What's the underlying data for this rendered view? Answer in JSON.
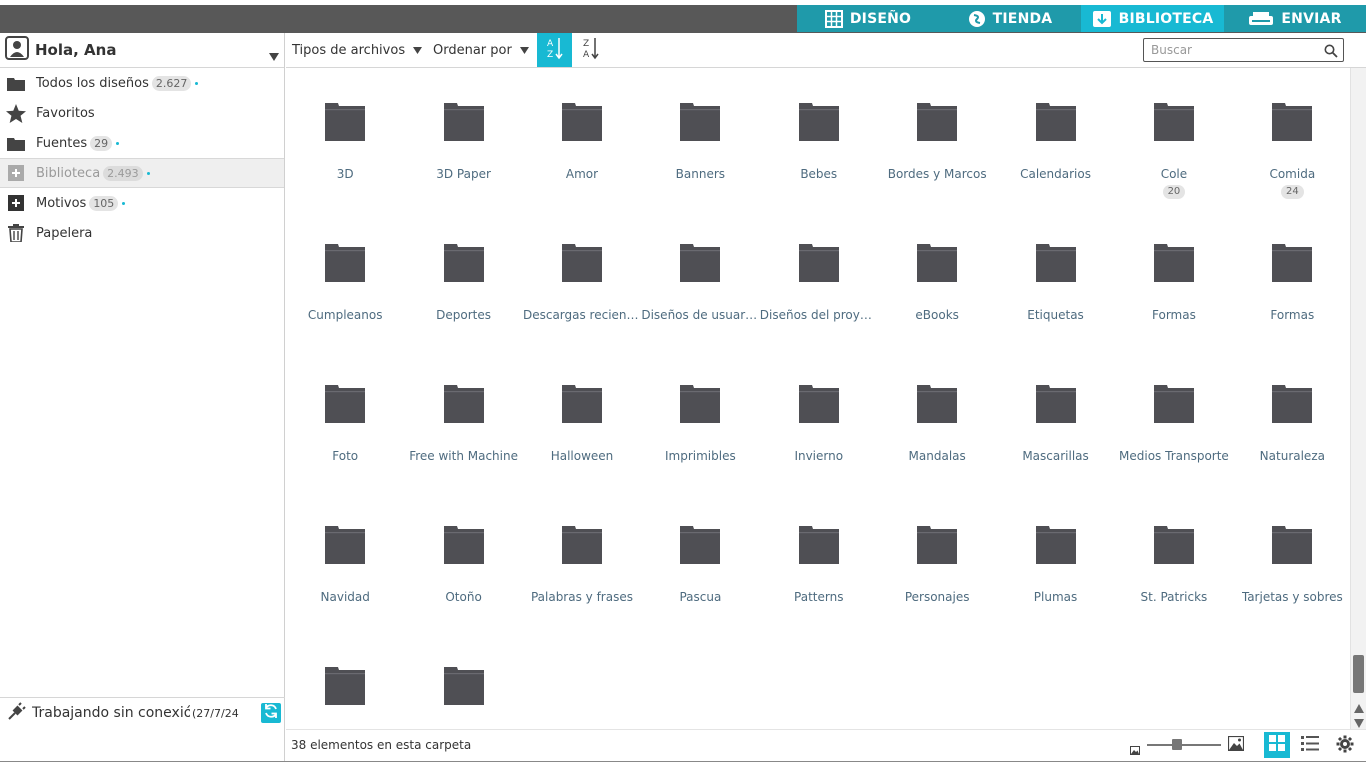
{
  "header": {
    "tabs": [
      {
        "label": "DISEÑO",
        "icon": "grid-icon"
      },
      {
        "label": "TIENDA",
        "icon": "store-icon"
      },
      {
        "label": "BIBLIOTECA",
        "icon": "download-icon"
      },
      {
        "label": "ENVIAR",
        "icon": "printer-icon"
      }
    ],
    "active_tab": "BIBLIOTECA",
    "colors": {
      "accent": "#18b9d3",
      "tab_bg": "#1f9aaa",
      "topbar": "#585858"
    }
  },
  "sidebar": {
    "user": "Hola, Ana",
    "items": [
      {
        "label": "Todos los diseños",
        "count": "2.627",
        "icon": "folder-icon"
      },
      {
        "label": "Favoritos",
        "count": "",
        "icon": "star-icon"
      },
      {
        "label": "Fuentes",
        "count": "29",
        "icon": "folder-icon"
      },
      {
        "label": "Biblioteca",
        "count": "2.493",
        "icon": "plus-box-icon"
      },
      {
        "label": "Motivos",
        "count": "105",
        "icon": "plus-box-icon"
      },
      {
        "label": "Papelera",
        "count": "",
        "icon": "trash-icon"
      }
    ],
    "offline_text": "Trabajando sin conexión",
    "offline_date": "(27/7/24"
  },
  "toolbar": {
    "file_types": "Tipos de archivos",
    "order_by": "Ordenar por",
    "sort_az": {
      "top": "A",
      "bottom": "Z"
    },
    "sort_za": {
      "top": "Z",
      "bottom": "A"
    },
    "search_placeholder": "Buscar"
  },
  "folders": [
    {
      "name": "3D",
      "count": ""
    },
    {
      "name": "3D Paper",
      "count": ""
    },
    {
      "name": "Amor",
      "count": ""
    },
    {
      "name": "Banners",
      "count": ""
    },
    {
      "name": "Bebes",
      "count": ""
    },
    {
      "name": "Bordes y Marcos",
      "count": ""
    },
    {
      "name": "Calendarios",
      "count": ""
    },
    {
      "name": "Cole",
      "count": "20"
    },
    {
      "name": "Comida",
      "count": "24"
    },
    {
      "name": "Cumpleanos",
      "count": ""
    },
    {
      "name": "Deportes",
      "count": ""
    },
    {
      "name": "Descargas recientes",
      "count": ""
    },
    {
      "name": "Diseños de usuarios",
      "count": ""
    },
    {
      "name": "Diseños del proye...",
      "count": ""
    },
    {
      "name": "eBooks",
      "count": ""
    },
    {
      "name": "Etiquetas",
      "count": ""
    },
    {
      "name": "Formas",
      "count": ""
    },
    {
      "name": "Formas",
      "count": ""
    },
    {
      "name": "Foto",
      "count": ""
    },
    {
      "name": "Free with Machine",
      "count": ""
    },
    {
      "name": "Halloween",
      "count": ""
    },
    {
      "name": "Imprimibles",
      "count": ""
    },
    {
      "name": "Invierno",
      "count": ""
    },
    {
      "name": "Mandalas",
      "count": ""
    },
    {
      "name": "Mascarillas",
      "count": ""
    },
    {
      "name": "Medios Transporte",
      "count": ""
    },
    {
      "name": "Naturaleza",
      "count": ""
    },
    {
      "name": "Navidad",
      "count": ""
    },
    {
      "name": "Otoño",
      "count": ""
    },
    {
      "name": "Palabras y frases",
      "count": ""
    },
    {
      "name": "Pascua",
      "count": ""
    },
    {
      "name": "Patterns",
      "count": ""
    },
    {
      "name": "Personajes",
      "count": ""
    },
    {
      "name": "Plumas",
      "count": ""
    },
    {
      "name": "St. Patricks",
      "count": ""
    },
    {
      "name": "Tarjetas y sobres",
      "count": ""
    },
    {
      "name": "",
      "count": ""
    },
    {
      "name": "",
      "count": ""
    }
  ],
  "status": {
    "items_text": "38 elementos en esta carpeta",
    "zoom_level": 0.4
  }
}
